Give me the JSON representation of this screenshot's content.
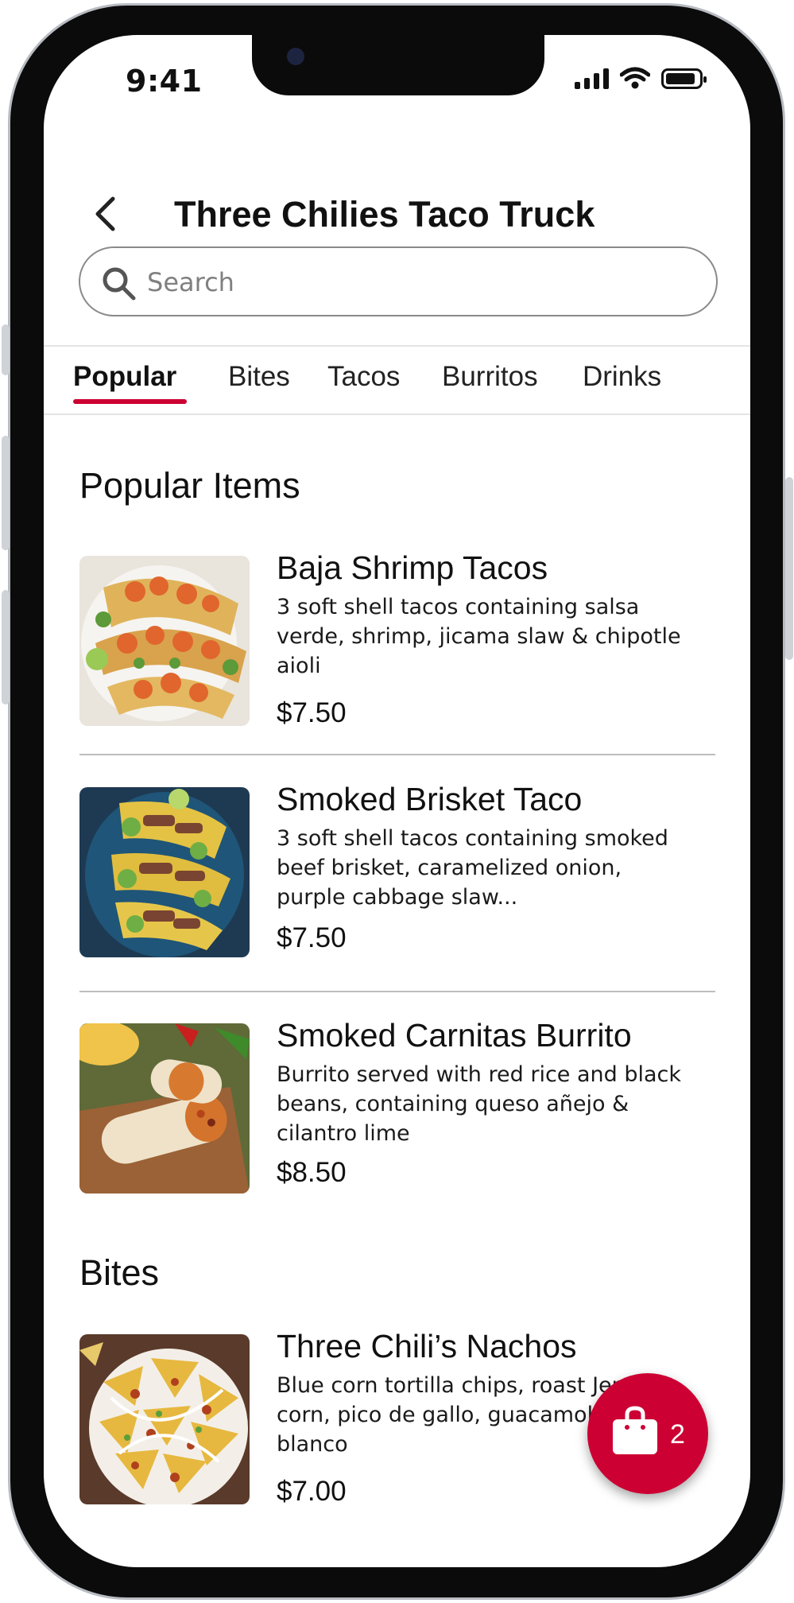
{
  "status_bar": {
    "time": "9:41"
  },
  "header": {
    "title": "Three Chilies Taco Truck"
  },
  "search": {
    "placeholder": "Search",
    "value": ""
  },
  "tabs": [
    {
      "label": "Popular",
      "active": true
    },
    {
      "label": "Bites",
      "active": false
    },
    {
      "label": "Tacos",
      "active": false
    },
    {
      "label": "Burritos",
      "active": false
    },
    {
      "label": "Drinks",
      "active": false
    }
  ],
  "sections": [
    {
      "title": "Popular Items",
      "items": [
        {
          "name": "Baja Shrimp Tacos",
          "description": "3 soft shell tacos containing salsa verde, shrimp, jicama slaw & chipotle aioli",
          "price": "$7.50"
        },
        {
          "name": "Smoked Brisket Taco",
          "description": "3 soft shell tacos containing smoked beef brisket, caramelized onion, purple cabbage slaw...",
          "price": "$7.50"
        },
        {
          "name": "Smoked Carnitas Burrito",
          "description": "Burrito served with red rice and black beans, containing queso añejo & cilantro lime",
          "price": "$8.50"
        }
      ]
    },
    {
      "title": "Bites",
      "items": [
        {
          "name": "Three Chili’s Nachos",
          "description": "Blue corn tortilla chips, roast Jersey corn, pico de gallo, guacamole, queso blanco",
          "price": "$7.00"
        }
      ]
    }
  ],
  "cart": {
    "count": "2"
  },
  "colors": {
    "accent": "#cc0033"
  }
}
